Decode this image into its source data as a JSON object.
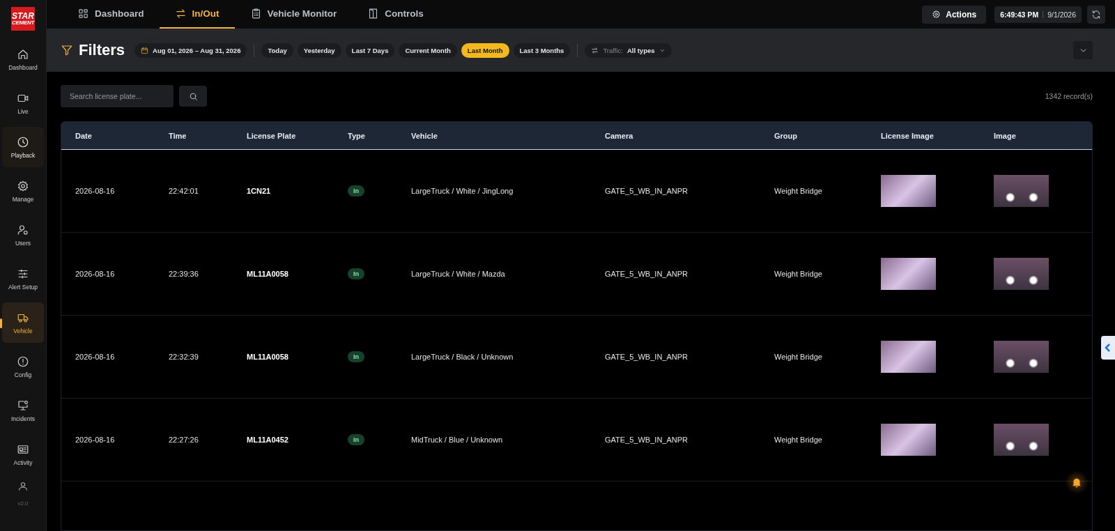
{
  "logo": {
    "line_1": "STAR",
    "line_2": "CEMENT"
  },
  "sidebar": {
    "items": [
      {
        "label": "Dashboard",
        "selected": false,
        "hovered": false
      },
      {
        "label": "Live",
        "selected": false,
        "hovered": false
      },
      {
        "label": "Playback",
        "selected": false,
        "hovered": true
      },
      {
        "label": "Manage",
        "selected": false,
        "hovered": false
      },
      {
        "label": "Users",
        "selected": false,
        "hovered": false
      },
      {
        "label": "Alert Setup",
        "selected": false,
        "hovered": false
      },
      {
        "label": "Vehicle",
        "selected": true,
        "hovered": false
      },
      {
        "label": "Config",
        "selected": false,
        "hovered": false
      },
      {
        "label": "Incidents",
        "selected": false,
        "hovered": false
      },
      {
        "label": "Activity",
        "selected": false,
        "hovered": false
      }
    ],
    "version": "v2.0"
  },
  "tabs": [
    {
      "label": "Dashboard",
      "selected": false
    },
    {
      "label": "In/Out",
      "selected": true
    },
    {
      "label": "Vehicle Monitor",
      "selected": false
    },
    {
      "label": "Controls",
      "selected": false
    }
  ],
  "actions": {
    "label": "Actions"
  },
  "clock": {
    "time": "6:49:43 PM",
    "date": "9/1/2026"
  },
  "filters": {
    "title": "Filters",
    "date_range": "Aug 01, 2026 – Aug 31, 2026",
    "presets": [
      {
        "label": "Today",
        "selected": false
      },
      {
        "label": "Yesterday",
        "selected": false
      },
      {
        "label": "Last 7 Days",
        "selected": false
      },
      {
        "label": "Current Month",
        "selected": false
      },
      {
        "label": "Last Month",
        "selected": true
      },
      {
        "label": "Last 3 Months",
        "selected": false
      }
    ],
    "traffic": {
      "label": "Traffic:",
      "value": "All types"
    }
  },
  "search": {
    "placeholder": "Search license plate..."
  },
  "record_count": "1342 record(s)",
  "table": {
    "columns": [
      "Date",
      "Time",
      "License Plate",
      "Type",
      "Vehicle",
      "Camera",
      "Group",
      "License Image",
      "Image"
    ],
    "rows": [
      {
        "date": "2026-08-16",
        "time": "22:42:01",
        "plate": "1CN21",
        "type": "In",
        "vehicle": "LargeTruck / White / JingLong",
        "camera": "GATE_5_WB_IN_ANPR",
        "group": "Weight Bridge"
      },
      {
        "date": "2026-08-16",
        "time": "22:39:36",
        "plate": "ML11A0058",
        "type": "In",
        "vehicle": "LargeTruck / White / Mazda",
        "camera": "GATE_5_WB_IN_ANPR",
        "group": "Weight Bridge"
      },
      {
        "date": "2026-08-16",
        "time": "22:32:39",
        "plate": "ML11A0058",
        "type": "In",
        "vehicle": "LargeTruck / Black / Unknown",
        "camera": "GATE_5_WB_IN_ANPR",
        "group": "Weight Bridge"
      },
      {
        "date": "2026-08-16",
        "time": "22:27:26",
        "plate": "ML11A0452",
        "type": "In",
        "vehicle": "MidTruck / Blue / Unknown",
        "camera": "GATE_5_WB_IN_ANPR",
        "group": "Weight Bridge"
      }
    ]
  }
}
